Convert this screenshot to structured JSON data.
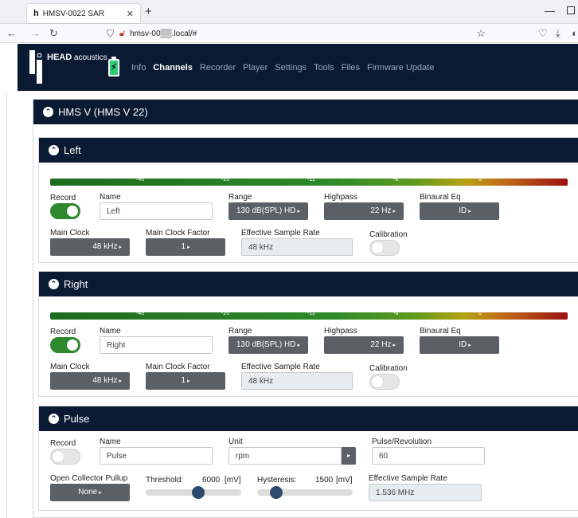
{
  "browser": {
    "tab_title": "HMSV-0022 SAR",
    "tab_favicon": "h",
    "url": "hmsv-00▒▒.local/#"
  },
  "app": {
    "brand": "HEAD",
    "brand_suffix": "acoustics",
    "menu": [
      "Info",
      "Channels",
      "Recorder",
      "Player",
      "Settings",
      "Tools",
      "Files",
      "Firmware Update"
    ],
    "active_menu": "Channels"
  },
  "device": {
    "title": "HMS V (HMS V 22)"
  },
  "meter_ticks": [
    "-40",
    "-20",
    "-12",
    "-6",
    "0"
  ],
  "labels": {
    "record": "Record",
    "name": "Name",
    "range": "Range",
    "highpass": "Highpass",
    "binaural": "Binaural Eq",
    "main_clock": "Main Clock",
    "main_clock_factor": "Main Clock Factor",
    "effective_rate": "Effective Sample Rate",
    "calibration": "Calibration",
    "unit": "Unit",
    "pulse_rev": "Pulse/Revolution",
    "open_collector": "Open Collector Pullup",
    "threshold": "Threshold:",
    "hysteresis": "Hysteresis:"
  },
  "channels": {
    "left": {
      "title": "Left",
      "record_on": true,
      "name": "Left",
      "range": "130 dB(SPL) HD",
      "highpass": "22 Hz",
      "binaural": "ID",
      "main_clock": "48 kHz",
      "main_clock_factor": "1",
      "effective_rate": "48 kHz",
      "calibration_on": false
    },
    "right": {
      "title": "Right",
      "record_on": true,
      "name": "Right",
      "range": "130 dB(SPL) HD",
      "highpass": "22 Hz",
      "binaural": "ID",
      "main_clock": "48 kHz",
      "main_clock_factor": "1",
      "effective_rate": "48 kHz",
      "calibration_on": false
    },
    "pulse": {
      "title": "Pulse",
      "record_on": false,
      "name": "Pulse",
      "unit": "rpm",
      "pulse_rev": "60",
      "open_collector": "None",
      "threshold_value": "6000",
      "threshold_unit": "[mV]",
      "threshold_fraction": 0.55,
      "hysteresis_value": "1500",
      "hysteresis_unit": "[mV]",
      "hysteresis_fraction": 0.2,
      "effective_rate": "1.536 MHz"
    }
  },
  "colors": {
    "nav_bg": "#0a1a33",
    "toggle_on": "#2e8a2e",
    "button_bg": "#5a6066"
  }
}
